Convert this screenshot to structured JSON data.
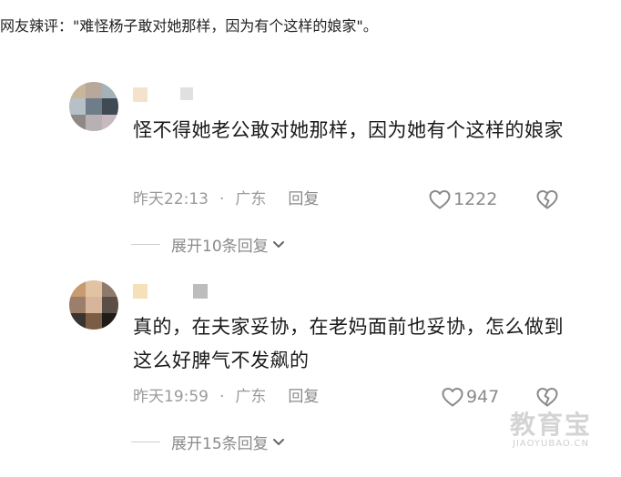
{
  "intro": {
    "text": "网友辣评：\"难怪杨子敢对她那样，因为有个这样的娘家\"。"
  },
  "comments": [
    {
      "avatar_colors": [
        "#c8b59a",
        "#b9a79c",
        "#a5b1b8",
        "#b6c0c6",
        "#6e7d8a",
        "#3f4a52",
        "#8d8a86",
        "#b8b1b3",
        "#c7b9bf"
      ],
      "name_colors": [
        "#f3e3cc",
        "#e0e0e0"
      ],
      "text": "怪不得她老公敢对她那样，因为她有个这样的娘家",
      "time": "昨天22:13",
      "separator": "·",
      "location": "广东",
      "reply_label": "回复",
      "likes": "1222",
      "expand_label": "展开10条回复"
    },
    {
      "avatar_colors": [
        "#c79a6f",
        "#e1c3a3",
        "#8e7a6a",
        "#9c7f6a",
        "#d7b59a",
        "#5b4e46",
        "#3a3330",
        "#7a5d44",
        "#1f1b19"
      ],
      "name_colors": [
        "#f5e1b8",
        "#bdbdbd"
      ],
      "text": "真的，在夫家妥协，在老妈面前也妥协，怎么做到这么好脾气不发飙的",
      "time": "昨天19:59",
      "separator": "·",
      "location": "广东",
      "reply_label": "回复",
      "likes": "947",
      "expand_label": "展开15条回复"
    }
  ],
  "watermark": {
    "cn": "教育宝",
    "en": "JIAOYUBAO.CN"
  }
}
